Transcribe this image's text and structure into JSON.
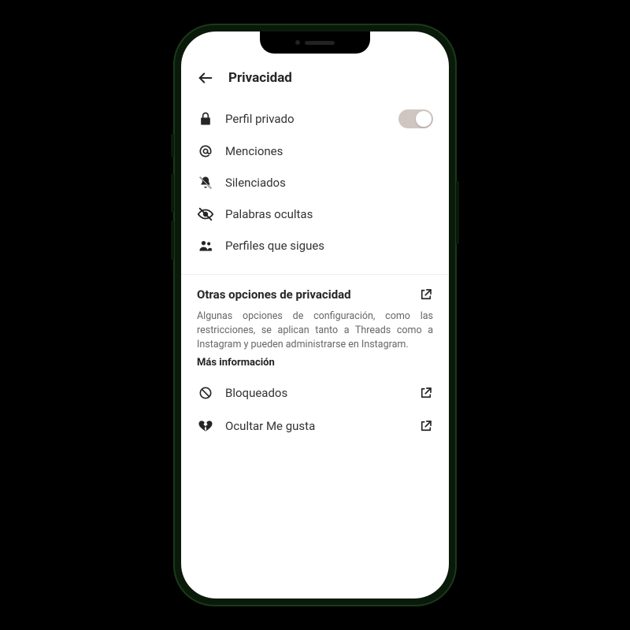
{
  "header": {
    "title": "Privacidad"
  },
  "items": {
    "private_profile": "Perfil privado",
    "mentions": "Menciones",
    "muted": "Silenciados",
    "hidden_words": "Palabras ocultas",
    "following_profiles": "Perfiles que sigues"
  },
  "section": {
    "title": "Otras opciones de privacidad",
    "description": "Algunas opciones de configuración, como las restricciones, se aplican tanto a Threads como a Instagram y pueden administrarse en Instagram.",
    "more_info": "Más información",
    "blocked": "Bloqueados",
    "hide_likes": "Ocultar Me gusta"
  },
  "state": {
    "private_profile_toggle": true
  }
}
